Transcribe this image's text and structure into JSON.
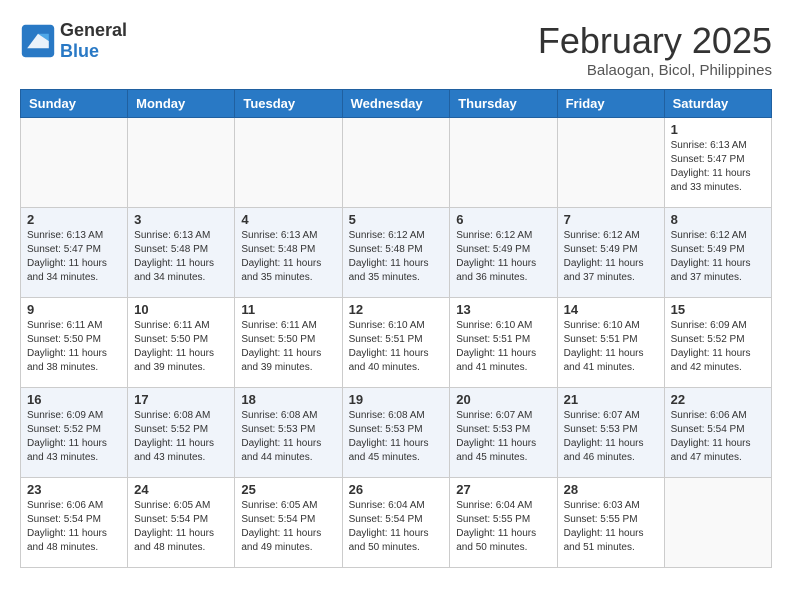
{
  "header": {
    "logo_general": "General",
    "logo_blue": "Blue",
    "month_year": "February 2025",
    "location": "Balaogan, Bicol, Philippines"
  },
  "weekdays": [
    "Sunday",
    "Monday",
    "Tuesday",
    "Wednesday",
    "Thursday",
    "Friday",
    "Saturday"
  ],
  "weeks": [
    [
      {
        "day": "",
        "info": ""
      },
      {
        "day": "",
        "info": ""
      },
      {
        "day": "",
        "info": ""
      },
      {
        "day": "",
        "info": ""
      },
      {
        "day": "",
        "info": ""
      },
      {
        "day": "",
        "info": ""
      },
      {
        "day": "1",
        "info": "Sunrise: 6:13 AM\nSunset: 5:47 PM\nDaylight: 11 hours\nand 33 minutes."
      }
    ],
    [
      {
        "day": "2",
        "info": "Sunrise: 6:13 AM\nSunset: 5:47 PM\nDaylight: 11 hours\nand 34 minutes."
      },
      {
        "day": "3",
        "info": "Sunrise: 6:13 AM\nSunset: 5:48 PM\nDaylight: 11 hours\nand 34 minutes."
      },
      {
        "day": "4",
        "info": "Sunrise: 6:13 AM\nSunset: 5:48 PM\nDaylight: 11 hours\nand 35 minutes."
      },
      {
        "day": "5",
        "info": "Sunrise: 6:12 AM\nSunset: 5:48 PM\nDaylight: 11 hours\nand 35 minutes."
      },
      {
        "day": "6",
        "info": "Sunrise: 6:12 AM\nSunset: 5:49 PM\nDaylight: 11 hours\nand 36 minutes."
      },
      {
        "day": "7",
        "info": "Sunrise: 6:12 AM\nSunset: 5:49 PM\nDaylight: 11 hours\nand 37 minutes."
      },
      {
        "day": "8",
        "info": "Sunrise: 6:12 AM\nSunset: 5:49 PM\nDaylight: 11 hours\nand 37 minutes."
      }
    ],
    [
      {
        "day": "9",
        "info": "Sunrise: 6:11 AM\nSunset: 5:50 PM\nDaylight: 11 hours\nand 38 minutes."
      },
      {
        "day": "10",
        "info": "Sunrise: 6:11 AM\nSunset: 5:50 PM\nDaylight: 11 hours\nand 39 minutes."
      },
      {
        "day": "11",
        "info": "Sunrise: 6:11 AM\nSunset: 5:50 PM\nDaylight: 11 hours\nand 39 minutes."
      },
      {
        "day": "12",
        "info": "Sunrise: 6:10 AM\nSunset: 5:51 PM\nDaylight: 11 hours\nand 40 minutes."
      },
      {
        "day": "13",
        "info": "Sunrise: 6:10 AM\nSunset: 5:51 PM\nDaylight: 11 hours\nand 41 minutes."
      },
      {
        "day": "14",
        "info": "Sunrise: 6:10 AM\nSunset: 5:51 PM\nDaylight: 11 hours\nand 41 minutes."
      },
      {
        "day": "15",
        "info": "Sunrise: 6:09 AM\nSunset: 5:52 PM\nDaylight: 11 hours\nand 42 minutes."
      }
    ],
    [
      {
        "day": "16",
        "info": "Sunrise: 6:09 AM\nSunset: 5:52 PM\nDaylight: 11 hours\nand 43 minutes."
      },
      {
        "day": "17",
        "info": "Sunrise: 6:08 AM\nSunset: 5:52 PM\nDaylight: 11 hours\nand 43 minutes."
      },
      {
        "day": "18",
        "info": "Sunrise: 6:08 AM\nSunset: 5:53 PM\nDaylight: 11 hours\nand 44 minutes."
      },
      {
        "day": "19",
        "info": "Sunrise: 6:08 AM\nSunset: 5:53 PM\nDaylight: 11 hours\nand 45 minutes."
      },
      {
        "day": "20",
        "info": "Sunrise: 6:07 AM\nSunset: 5:53 PM\nDaylight: 11 hours\nand 45 minutes."
      },
      {
        "day": "21",
        "info": "Sunrise: 6:07 AM\nSunset: 5:53 PM\nDaylight: 11 hours\nand 46 minutes."
      },
      {
        "day": "22",
        "info": "Sunrise: 6:06 AM\nSunset: 5:54 PM\nDaylight: 11 hours\nand 47 minutes."
      }
    ],
    [
      {
        "day": "23",
        "info": "Sunrise: 6:06 AM\nSunset: 5:54 PM\nDaylight: 11 hours\nand 48 minutes."
      },
      {
        "day": "24",
        "info": "Sunrise: 6:05 AM\nSunset: 5:54 PM\nDaylight: 11 hours\nand 48 minutes."
      },
      {
        "day": "25",
        "info": "Sunrise: 6:05 AM\nSunset: 5:54 PM\nDaylight: 11 hours\nand 49 minutes."
      },
      {
        "day": "26",
        "info": "Sunrise: 6:04 AM\nSunset: 5:54 PM\nDaylight: 11 hours\nand 50 minutes."
      },
      {
        "day": "27",
        "info": "Sunrise: 6:04 AM\nSunset: 5:55 PM\nDaylight: 11 hours\nand 50 minutes."
      },
      {
        "day": "28",
        "info": "Sunrise: 6:03 AM\nSunset: 5:55 PM\nDaylight: 11 hours\nand 51 minutes."
      },
      {
        "day": "",
        "info": ""
      }
    ]
  ]
}
